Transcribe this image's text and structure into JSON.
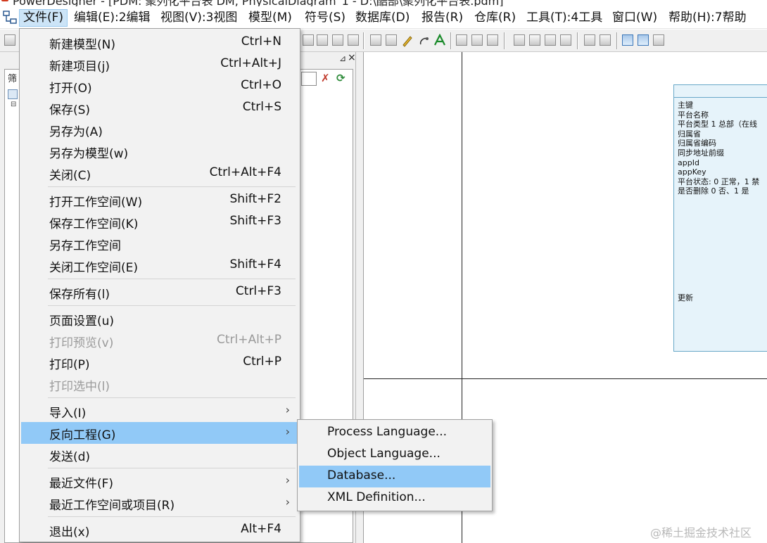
{
  "window": {
    "title": "PowerDesigner - [PDM: 聚列化平台表 DM, PhysicalDiagram_1 - D:\\酷部\\聚列化平台表.pdm]"
  },
  "menubar": {
    "items": [
      {
        "label": "文件(F)",
        "active": true
      },
      {
        "label": "编辑(E):2编辑"
      },
      {
        "label": "视图(V):3视图"
      },
      {
        "label": "模型(M)"
      },
      {
        "label": "符号(S)"
      },
      {
        "label": "数据库(D)"
      },
      {
        "label": "报告(R)"
      },
      {
        "label": "仓库(R)"
      },
      {
        "label": "工具(T):4工具"
      },
      {
        "label": "窗口(W)"
      },
      {
        "label": "帮助(H):7帮助"
      }
    ]
  },
  "browser": {
    "filter_label": "筛"
  },
  "file_menu": {
    "items": [
      {
        "label": "新建模型(N)",
        "shortcut": "Ctrl+N"
      },
      {
        "label": "新建项目(j)",
        "shortcut": "Ctrl+Alt+J"
      },
      {
        "label": "打开(O)",
        "shortcut": "Ctrl+O"
      },
      {
        "label": "保存(S)",
        "shortcut": "Ctrl+S"
      },
      {
        "label": "另存为(A)",
        "shortcut": ""
      },
      {
        "label": "另存为模型(w)",
        "shortcut": ""
      },
      {
        "label": "关闭(C)",
        "shortcut": "Ctrl+Alt+F4"
      },
      {
        "label": "打开工作空间(W)",
        "shortcut": "Shift+F2"
      },
      {
        "label": "保存工作空间(K)",
        "shortcut": "Shift+F3"
      },
      {
        "label": "另存工作空间",
        "shortcut": ""
      },
      {
        "label": "关闭工作空间(E)",
        "shortcut": "Shift+F4"
      },
      {
        "label": "保存所有(l)",
        "shortcut": "Ctrl+F3"
      },
      {
        "label": "页面设置(u)",
        "shortcut": ""
      },
      {
        "label": "打印预览(v)",
        "shortcut": "Ctrl+Alt+P",
        "disabled": true
      },
      {
        "label": "打印(P)",
        "shortcut": "Ctrl+P"
      },
      {
        "label": "打印选中(l)",
        "shortcut": "",
        "disabled": true
      },
      {
        "label": "导入(I)",
        "submenu": true
      },
      {
        "label": "反向工程(G)",
        "submenu": true,
        "highlighted": true
      },
      {
        "label": "发送(d)",
        "shortcut": ""
      },
      {
        "label": "最近文件(F)",
        "submenu": true
      },
      {
        "label": "最近工作空间或项目(R)",
        "submenu": true
      },
      {
        "label": "退出(x)",
        "shortcut": "Alt+F4"
      }
    ]
  },
  "reverse_engineering_submenu": {
    "items": [
      {
        "label": "Process Language..."
      },
      {
        "label": "Object Language..."
      },
      {
        "label": "Database...",
        "highlighted": true
      },
      {
        "label": "XML Definition..."
      }
    ]
  },
  "diagram": {
    "entity_rows": [
      "主键",
      "平台名称",
      "平台类型 1 总部（在线",
      "归属省",
      "归属省编码",
      "同步地址前缀",
      "appId",
      "appKey",
      "平台状态: 0 正常，1 禁",
      "是否删除  0 否、1 是"
    ],
    "entity_footer": "更新"
  },
  "watermark": "@稀土掘金技术社区",
  "colors": {
    "menu_highlight": "#91c9f7",
    "menubar_active": "#cce4f7",
    "entity_fill": "#e6f3fa",
    "entity_border": "#68a8c8"
  }
}
